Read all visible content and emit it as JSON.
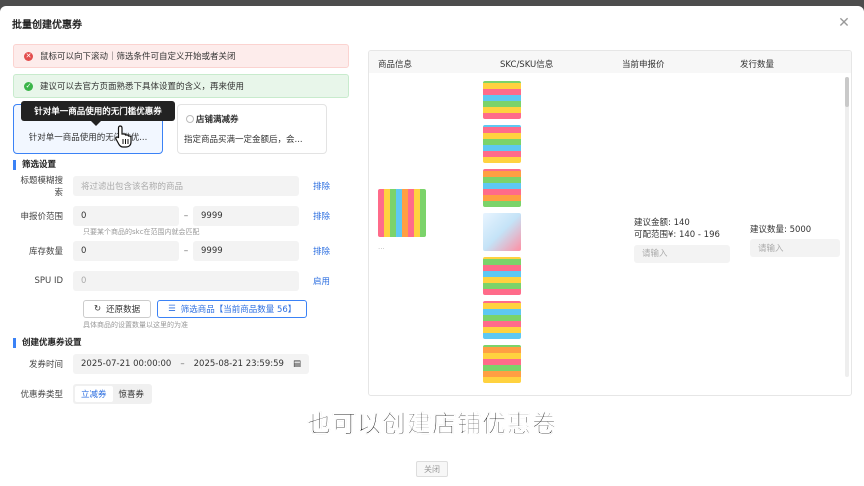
{
  "modal": {
    "title": "批量创建优惠券",
    "close_icon": "close-icon"
  },
  "alerts": [
    {
      "text": "鼠标可以向下滚动｜筛选条件可自定义开始或者关闭",
      "color": "#e34d4d"
    },
    {
      "text": "建议可以去官方页面熟悉下具体设置的含义，再来使用",
      "color": "#3bb54a"
    }
  ],
  "coupon_types": [
    {
      "desc": "针对单一商品使用的无门槛优...",
      "selected": true
    },
    {
      "title": "店铺满减券",
      "desc": "指定商品买满一定金额后，会..."
    }
  ],
  "tooltip": "针对单一商品使用的无门槛优惠券",
  "filter": {
    "section_title": "筛选设置",
    "title_search": {
      "label": "标题模糊搜索",
      "placeholder": "将过滤出包含该名称的商品",
      "action": "排除"
    },
    "price_range": {
      "label": "申报价范围",
      "min": "0",
      "max": "9999",
      "action": "排除",
      "hint": "只要某个商品的skc在范围内就会匹配"
    },
    "stock": {
      "label": "库存数量",
      "min": "0",
      "max": "9999",
      "action": "排除"
    },
    "spu": {
      "label": "SPU ID",
      "value": "0",
      "action": "启用"
    },
    "reset_button": "还原数据",
    "filter_button": "筛选商品【当前商品数量 56】",
    "filter_hint": "具体商品的设置数量以这里的为准"
  },
  "create": {
    "section_title": "创建优惠券设置",
    "time_label": "发券时间",
    "start": "2025-07-21 00:00:00",
    "end": "2025-08-21 23:59:59",
    "type_label": "优惠券类型",
    "types": [
      "立减券",
      "惊喜券"
    ]
  },
  "table": {
    "headers": [
      "商品信息",
      "SKC/SKU信息",
      "当前申报价",
      "发行数量"
    ],
    "product_text": "...",
    "price_lines": [
      "建议金额: 140",
      "可配范围¥: 140 - 196"
    ],
    "price_placeholder": "请输入",
    "issue_line": "建议数量: 5000",
    "issue_placeholder": "请输入"
  },
  "caption": "也可以创建店铺优惠卷",
  "footer": {
    "close_button": "关闭"
  }
}
